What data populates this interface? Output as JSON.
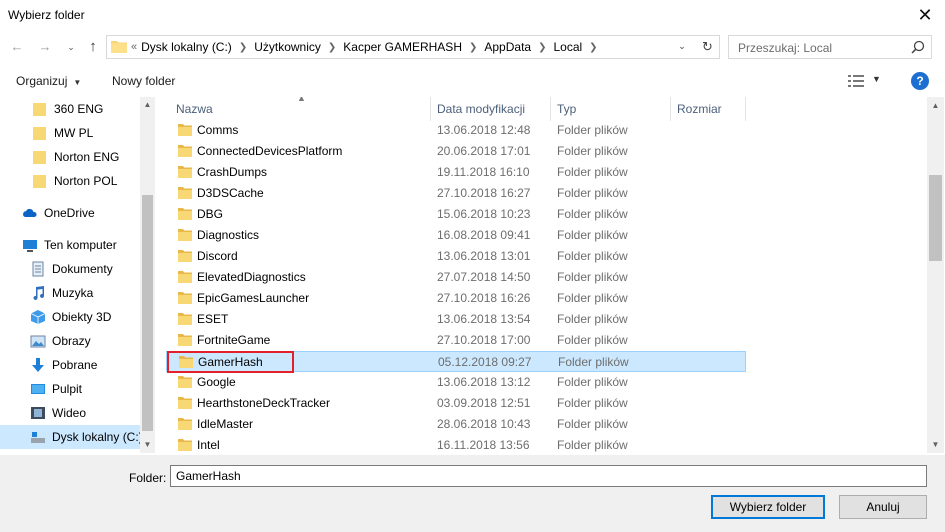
{
  "window": {
    "title": "Wybierz folder",
    "close_label": "✕"
  },
  "nav": {
    "back_label": "←",
    "forward_label": "→",
    "recent_label": "⌄",
    "up_label": "↑"
  },
  "address": {
    "overflow_label": "«",
    "crumbs": [
      "Dysk lokalny (C:)",
      "Użytkownicy",
      "Kacper GAMERHASH",
      "AppData",
      "Local"
    ],
    "dropdown_label": "⌄",
    "refresh_label": "↻"
  },
  "search": {
    "placeholder": "Przeszukaj: Local"
  },
  "toolbar": {
    "organize_label": "Organizuj",
    "new_folder_label": "Nowy folder",
    "help_label": "?"
  },
  "sidebar": {
    "items": [
      {
        "label": "360 ENG",
        "icon": "folder-icon"
      },
      {
        "label": "MW PL",
        "icon": "folder-icon"
      },
      {
        "label": "Norton ENG",
        "icon": "folder-icon"
      },
      {
        "label": "Norton POL",
        "icon": "folder-icon"
      },
      {
        "label": "OneDrive",
        "icon": "cloud-icon"
      },
      {
        "label": "Ten komputer",
        "icon": "computer-icon"
      },
      {
        "label": "Dokumenty",
        "icon": "documents-icon"
      },
      {
        "label": "Muzyka",
        "icon": "music-icon"
      },
      {
        "label": "Obiekty 3D",
        "icon": "cube-icon"
      },
      {
        "label": "Obrazy",
        "icon": "pictures-icon"
      },
      {
        "label": "Pobrane",
        "icon": "download-icon"
      },
      {
        "label": "Pulpit",
        "icon": "desktop-icon"
      },
      {
        "label": "Wideo",
        "icon": "video-icon"
      },
      {
        "label": "Dysk lokalny (C:)",
        "icon": "drive-icon"
      }
    ]
  },
  "columns": {
    "name": "Nazwa",
    "date": "Data modyfikacji",
    "type": "Typ",
    "size": "Rozmiar"
  },
  "files": [
    {
      "name": "Comms",
      "date": "13.06.2018 12:48",
      "type": "Folder plików"
    },
    {
      "name": "ConnectedDevicesPlatform",
      "date": "20.06.2018 17:01",
      "type": "Folder plików"
    },
    {
      "name": "CrashDumps",
      "date": "19.11.2018 16:10",
      "type": "Folder plików"
    },
    {
      "name": "D3DSCache",
      "date": "27.10.2018 16:27",
      "type": "Folder plików"
    },
    {
      "name": "DBG",
      "date": "15.06.2018 10:23",
      "type": "Folder plików"
    },
    {
      "name": "Diagnostics",
      "date": "16.08.2018 09:41",
      "type": "Folder plików"
    },
    {
      "name": "Discord",
      "date": "13.06.2018 13:01",
      "type": "Folder plików"
    },
    {
      "name": "ElevatedDiagnostics",
      "date": "27.07.2018 14:50",
      "type": "Folder plików"
    },
    {
      "name": "EpicGamesLauncher",
      "date": "27.10.2018 16:26",
      "type": "Folder plików"
    },
    {
      "name": "ESET",
      "date": "13.06.2018 13:54",
      "type": "Folder plików"
    },
    {
      "name": "FortniteGame",
      "date": "27.10.2018 17:00",
      "type": "Folder plików"
    },
    {
      "name": "GamerHash",
      "date": "05.12.2018 09:27",
      "type": "Folder plików"
    },
    {
      "name": "Google",
      "date": "13.06.2018 13:12",
      "type": "Folder plików"
    },
    {
      "name": "HearthstoneDeckTracker",
      "date": "03.09.2018 12:51",
      "type": "Folder plików"
    },
    {
      "name": "IdleMaster",
      "date": "28.06.2018 10:43",
      "type": "Folder plików"
    },
    {
      "name": "Intel",
      "date": "16.11.2018 13:56",
      "type": "Folder plików"
    }
  ],
  "footer": {
    "folder_label": "Folder:",
    "folder_value": "GamerHash",
    "select_label": "Wybierz folder",
    "cancel_label": "Anuluj"
  },
  "colors": {
    "accent": "#0078d7",
    "selection": "#cce8ff",
    "highlight_outline": "#e2212a",
    "folder": "#f8d775"
  }
}
